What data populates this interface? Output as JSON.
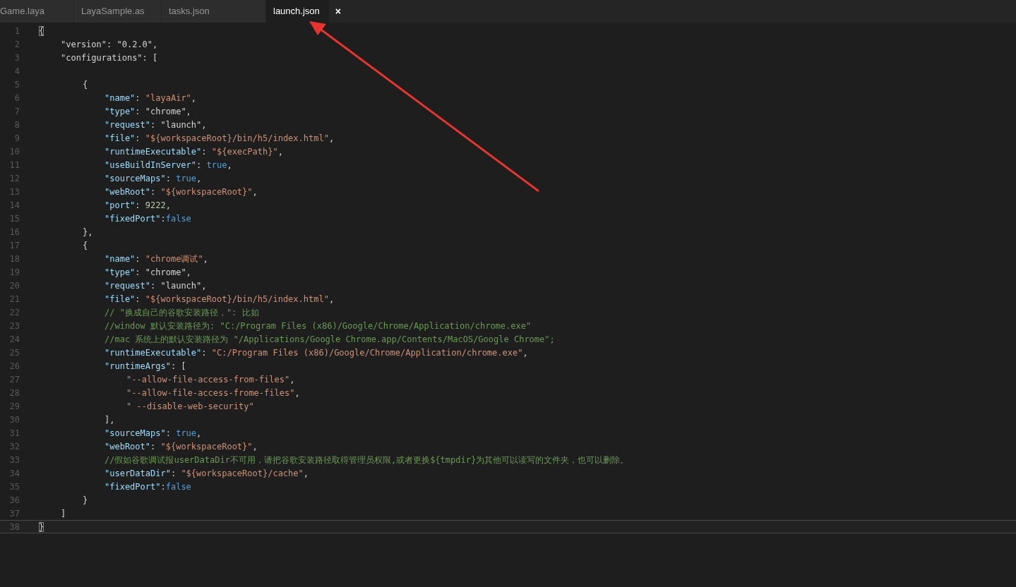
{
  "tabs": [
    {
      "label": "Game.laya",
      "selected": false
    },
    {
      "label": "LayaSample.as",
      "selected": false
    },
    {
      "label": "tasks.json",
      "selected": false
    },
    {
      "label": "launch.json",
      "selected": true,
      "close": "×"
    }
  ],
  "editor": {
    "lines": [
      {
        "number": "1",
        "current": false,
        "tokens": [
          {
            "kind": "bracket",
            "text": "{"
          }
        ]
      },
      {
        "number": "2",
        "current": false,
        "tokens": [
          {
            "kind": "string",
            "text": "\t\"version\""
          },
          {
            "kind": "punct",
            "text": ": "
          },
          {
            "kind": "string",
            "text": "\"0.2.0\""
          },
          {
            "kind": "punct",
            "text": ","
          }
        ]
      },
      {
        "number": "3",
        "current": false,
        "tokens": [
          {
            "kind": "string",
            "text": "\t\"configurations\""
          },
          {
            "kind": "punct",
            "text": ": ["
          }
        ]
      },
      {
        "number": "4",
        "current": false
      },
      {
        "number": "5",
        "current": false,
        "tokens": [
          {
            "kind": "punct",
            "text": "\t\t{"
          }
        ]
      },
      {
        "number": "6",
        "current": false,
        "tokens": [
          {
            "kind": "key",
            "text": "\t\t\t\"name\""
          },
          {
            "kind": "punct",
            "text": ": "
          },
          {
            "kind": "value",
            "text": "\"layaAir\""
          },
          {
            "kind": "punct",
            "text": ","
          }
        ]
      },
      {
        "number": "7",
        "current": false,
        "tokens": [
          {
            "kind": "key",
            "text": "\t\t\t\"type\""
          },
          {
            "kind": "punct",
            "text": ": "
          },
          {
            "kind": "string",
            "text": "\"chrome\""
          },
          {
            "kind": "punct",
            "text": ","
          }
        ]
      },
      {
        "number": "8",
        "current": false,
        "tokens": [
          {
            "kind": "key",
            "text": "\t\t\t\"request\""
          },
          {
            "kind": "punct",
            "text": ": "
          },
          {
            "kind": "string",
            "text": "\"launch\""
          },
          {
            "kind": "punct",
            "text": ","
          }
        ]
      },
      {
        "number": "9",
        "current": false,
        "tokens": [
          {
            "kind": "key",
            "text": "\t\t\t\"file\""
          },
          {
            "kind": "punct",
            "text": ": "
          },
          {
            "kind": "value",
            "text": "\"${workspaceRoot}/bin/h5/index.html\""
          },
          {
            "kind": "punct",
            "text": ","
          }
        ]
      },
      {
        "number": "10",
        "current": false,
        "tokens": [
          {
            "kind": "key",
            "text": "\t\t\t\"runtimeExecutable\""
          },
          {
            "kind": "punct",
            "text": ": "
          },
          {
            "kind": "value",
            "text": "\"${execPath}\""
          },
          {
            "kind": "punct",
            "text": ","
          }
        ]
      },
      {
        "number": "11",
        "current": false,
        "tokens": [
          {
            "kind": "key",
            "text": "\t\t\t\"useBuildInServer\""
          },
          {
            "kind": "punct",
            "text": ": "
          },
          {
            "kind": "keyword",
            "text": "true"
          },
          {
            "kind": "punct",
            "text": ","
          }
        ]
      },
      {
        "number": "12",
        "current": false,
        "tokens": [
          {
            "kind": "key",
            "text": "\t\t\t\"sourceMaps\""
          },
          {
            "kind": "punct",
            "text": ": "
          },
          {
            "kind": "keyword",
            "text": "true"
          },
          {
            "kind": "punct",
            "text": ","
          }
        ]
      },
      {
        "number": "13",
        "current": false,
        "tokens": [
          {
            "kind": "key",
            "text": "\t\t\t\"webRoot\""
          },
          {
            "kind": "punct",
            "text": ": "
          },
          {
            "kind": "value",
            "text": "\"${workspaceRoot}\""
          },
          {
            "kind": "punct",
            "text": ","
          }
        ]
      },
      {
        "number": "14",
        "current": false,
        "tokens": [
          {
            "kind": "key",
            "text": "\t\t\t\"port\""
          },
          {
            "kind": "punct",
            "text": ": "
          },
          {
            "kind": "number",
            "text": "9222"
          },
          {
            "kind": "punct",
            "text": ","
          }
        ]
      },
      {
        "number": "15",
        "current": false,
        "tokens": [
          {
            "kind": "key",
            "text": "\t\t\t\"fixedPort\""
          },
          {
            "kind": "punct",
            "text": ":"
          },
          {
            "kind": "keyword",
            "text": "false"
          }
        ]
      },
      {
        "number": "16",
        "current": false,
        "tokens": [
          {
            "kind": "punct",
            "text": "\t\t},"
          }
        ]
      },
      {
        "number": "17",
        "current": false,
        "tokens": [
          {
            "kind": "punct",
            "text": "\t\t{"
          }
        ]
      },
      {
        "number": "18",
        "current": false,
        "tokens": [
          {
            "kind": "key",
            "text": "\t\t\t\"name\""
          },
          {
            "kind": "punct",
            "text": ": "
          },
          {
            "kind": "value",
            "text": "\"chrome调试\""
          },
          {
            "kind": "punct",
            "text": ","
          }
        ]
      },
      {
        "number": "19",
        "current": false,
        "tokens": [
          {
            "kind": "key",
            "text": "\t\t\t\"type\""
          },
          {
            "kind": "punct",
            "text": ": "
          },
          {
            "kind": "string",
            "text": "\"chrome\""
          },
          {
            "kind": "punct",
            "text": ","
          }
        ]
      },
      {
        "number": "20",
        "current": false,
        "tokens": [
          {
            "kind": "key",
            "text": "\t\t\t\"request\""
          },
          {
            "kind": "punct",
            "text": ": "
          },
          {
            "kind": "string",
            "text": "\"launch\""
          },
          {
            "kind": "punct",
            "text": ","
          }
        ]
      },
      {
        "number": "21",
        "current": false,
        "tokens": [
          {
            "kind": "key",
            "text": "\t\t\t\"file\""
          },
          {
            "kind": "punct",
            "text": ": "
          },
          {
            "kind": "value",
            "text": "\"${workspaceRoot}/bin/h5/index.html\""
          },
          {
            "kind": "punct",
            "text": ","
          }
        ]
      },
      {
        "number": "22",
        "current": false,
        "tokens": [
          {
            "kind": "comment",
            "text": "\t\t\t// \"换成自己的谷歌安装路径，\": 比如"
          }
        ]
      },
      {
        "number": "23",
        "current": false,
        "tokens": [
          {
            "kind": "comment",
            "text": "\t\t\t//window 默认安装路径为: \"C:/Program Files (x86)/Google/Chrome/Application/chrome.exe\""
          }
        ]
      },
      {
        "number": "24",
        "current": false,
        "tokens": [
          {
            "kind": "comment",
            "text": "\t\t\t//mac 系统上的默认安装路径为 \"/Applications/Google Chrome.app/Contents/MacOS/Google Chrome\";"
          }
        ]
      },
      {
        "number": "25",
        "current": false,
        "tokens": [
          {
            "kind": "key",
            "text": "\t\t\t\"runtimeExecutable\""
          },
          {
            "kind": "punct",
            "text": ": "
          },
          {
            "kind": "value",
            "text": "\"C:/Program Files (x86)/Google/Chrome/Application/chrome.exe\""
          },
          {
            "kind": "punct",
            "text": ","
          }
        ]
      },
      {
        "number": "26",
        "current": false,
        "tokens": [
          {
            "kind": "key",
            "text": "\t\t\t\"runtimeArgs\""
          },
          {
            "kind": "punct",
            "text": ": ["
          }
        ]
      },
      {
        "number": "27",
        "current": false,
        "tokens": [
          {
            "kind": "value",
            "text": "\t\t\t\t\"--allow-file-access-from-files\""
          },
          {
            "kind": "punct",
            "text": ","
          }
        ]
      },
      {
        "number": "28",
        "current": false,
        "tokens": [
          {
            "kind": "value",
            "text": "\t\t\t\t\"--allow-file-access-frome-files\""
          },
          {
            "kind": "punct",
            "text": ","
          }
        ]
      },
      {
        "number": "29",
        "current": false,
        "tokens": [
          {
            "kind": "value",
            "text": "\t\t\t\t\" --disable-web-security\""
          }
        ]
      },
      {
        "number": "30",
        "current": false,
        "tokens": [
          {
            "kind": "punct",
            "text": "\t\t\t],"
          }
        ]
      },
      {
        "number": "31",
        "current": false,
        "tokens": [
          {
            "kind": "key",
            "text": "\t\t\t\"sourceMaps\""
          },
          {
            "kind": "punct",
            "text": ": "
          },
          {
            "kind": "keyword",
            "text": "true"
          },
          {
            "kind": "punct",
            "text": ","
          }
        ]
      },
      {
        "number": "32",
        "current": false,
        "tokens": [
          {
            "kind": "key",
            "text": "\t\t\t\"webRoot\""
          },
          {
            "kind": "punct",
            "text": ": "
          },
          {
            "kind": "value",
            "text": "\"${workspaceRoot}\""
          },
          {
            "kind": "punct",
            "text": ","
          }
        ]
      },
      {
        "number": "33",
        "current": false,
        "tokens": [
          {
            "kind": "comment",
            "text": "\t\t\t//假如谷歌调试报userDataDir不可用，请把谷歌安装路径取得管理员权限,或者更换${tmpdir}为其他可以读写的文件夹，也可以删除。"
          }
        ]
      },
      {
        "number": "34",
        "current": false,
        "tokens": [
          {
            "kind": "key",
            "text": "\t\t\t\"userDataDir\""
          },
          {
            "kind": "punct",
            "text": ": "
          },
          {
            "kind": "value",
            "text": "\"${workspaceRoot}/cache\""
          },
          {
            "kind": "punct",
            "text": ","
          }
        ]
      },
      {
        "number": "35",
        "current": false,
        "tokens": [
          {
            "kind": "key",
            "text": "\t\t\t\"fixedPort\""
          },
          {
            "kind": "punct",
            "text": ":"
          },
          {
            "kind": "keyword",
            "text": "false"
          }
        ]
      },
      {
        "number": "36",
        "current": false,
        "tokens": [
          {
            "kind": "punct",
            "text": "\t\t}"
          }
        ]
      },
      {
        "number": "37",
        "current": false,
        "tokens": [
          {
            "kind": "punct",
            "text": "\t]"
          }
        ]
      },
      {
        "number": "38",
        "current": true,
        "tokens": [
          {
            "kind": "bracket",
            "text": "}"
          }
        ]
      }
    ]
  }
}
